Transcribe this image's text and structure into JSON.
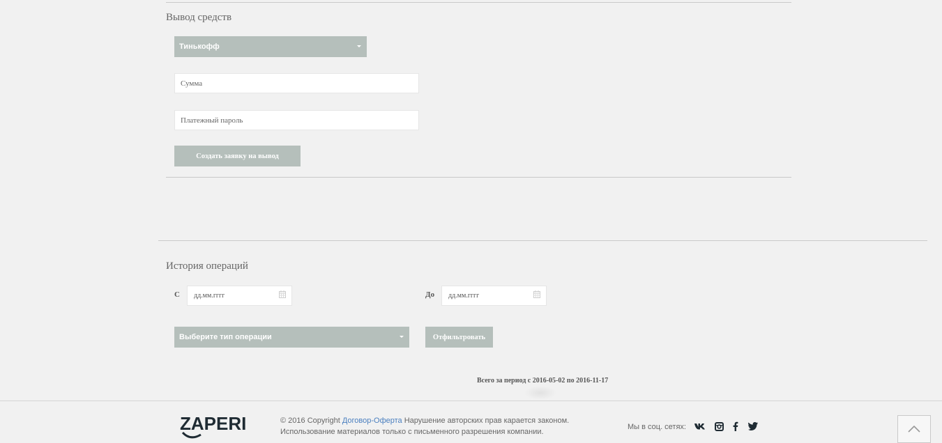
{
  "withdraw": {
    "title": "Вывод средств",
    "method_selected": "Тинькофф",
    "amount_placeholder": "Сумма",
    "password_placeholder": "Платежный пароль",
    "submit_label": "Создать заявку на вывод"
  },
  "history": {
    "title": "История операций",
    "from_label": "С",
    "to_label": "До",
    "from_placeholder": "дд.мм.гггг",
    "to_placeholder": "дд.мм.гггг",
    "type_selected": "Выберите тип операции",
    "filter_label": "Отфильтровать",
    "total_text": "Всего за период с 2016-05-02 по 2016-11-17"
  },
  "footer": {
    "logo_text": "ZAPERI",
    "copyright_prefix": "© 2016 Copyright",
    "offer_link": "Договор-Оферта",
    "line1_suffix": "Нарушение авторских прав карается законом.",
    "line2": "Использование материалов только с письменного разрешения компании.",
    "social_label": "Мы в соц. сетях:",
    "social_icons": [
      "vk-icon",
      "instagram-icon",
      "facebook-icon",
      "twitter-icon"
    ]
  },
  "colors": {
    "button_bg": "#b5bfbb",
    "page_bg": "#f1f1f1",
    "link": "#4a7fbf",
    "social_icon": "#1f2b33"
  }
}
